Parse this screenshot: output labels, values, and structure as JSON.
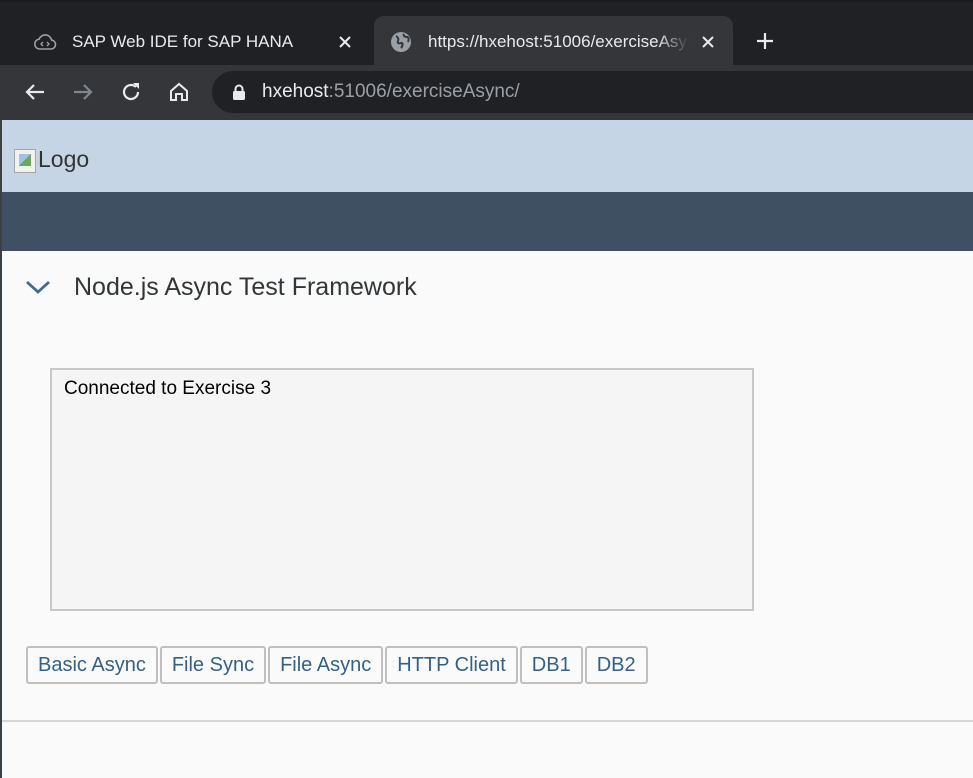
{
  "browser": {
    "tabs": [
      {
        "title": "SAP Web IDE for SAP HANA",
        "favicon": "cloud-icon",
        "active": false
      },
      {
        "title": "https://hxehost:51006/exerciseAsync/",
        "favicon": "globe-icon",
        "active": true
      }
    ],
    "address": {
      "host": "hxehost",
      "rest": ":51006/exerciseAsync/"
    },
    "colors": {
      "tabstrip": "#202124",
      "toolbar": "#35363a",
      "text": "#e8eaed"
    }
  },
  "page": {
    "logo_alt": "Logo",
    "panel_title": "Node.js Async Test Framework",
    "output_text": "Connected to Exercise 3",
    "buttons": [
      {
        "label": "Basic Async"
      },
      {
        "label": "File Sync"
      },
      {
        "label": "File Async"
      },
      {
        "label": "HTTP Client"
      },
      {
        "label": "DB1"
      },
      {
        "label": "DB2"
      }
    ],
    "colors": {
      "header": "#c5d5e6",
      "shell": "#3e5062",
      "button_text": "#346187"
    }
  }
}
